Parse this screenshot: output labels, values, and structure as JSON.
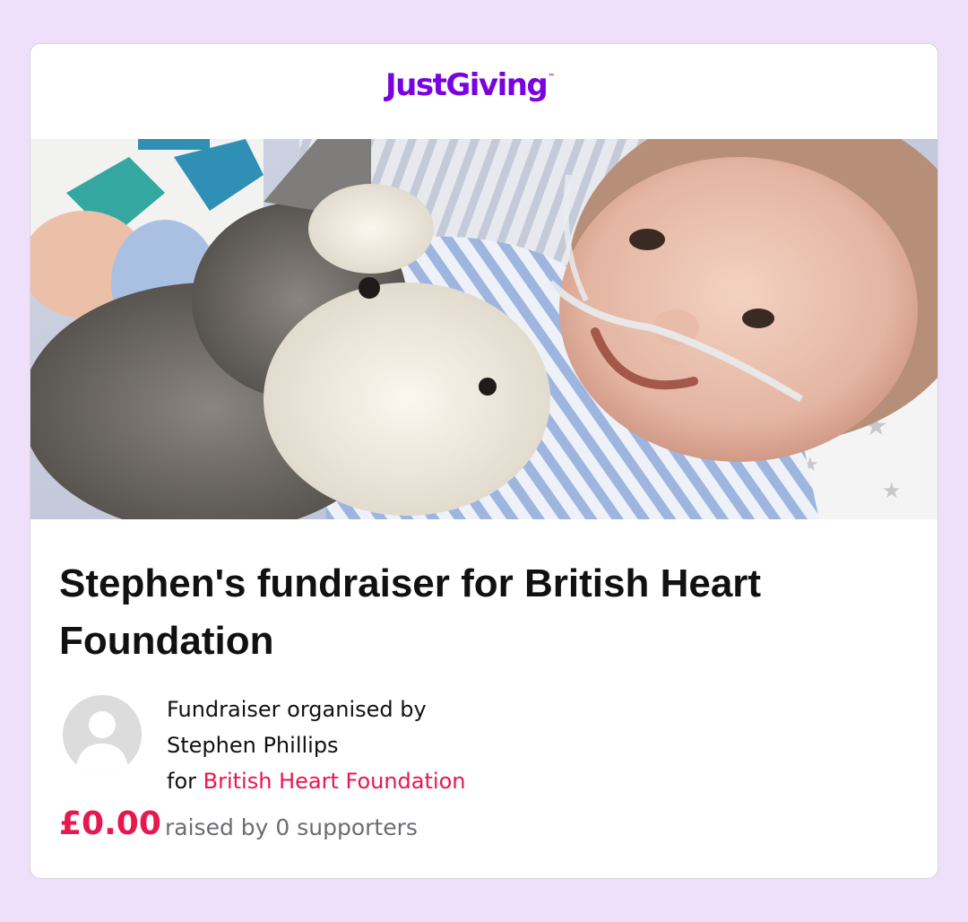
{
  "brand": {
    "name": "JustGiving",
    "trademark": "™",
    "color": "#7a04dd"
  },
  "hero": {
    "image": "baby-with-plush-toy-photo"
  },
  "fundraiser": {
    "title": "Stephen's fundraiser for British Heart Foundation",
    "organised_label": "Fundraiser organised by",
    "organiser": "Stephen Phillips",
    "for_label": "for",
    "charity": "British Heart Foundation",
    "amount": "£0.00",
    "raised_text": "raised by 0 supporters",
    "accent_color": "#e8174f"
  },
  "avatar": {
    "icon": "default-user-avatar-icon"
  }
}
